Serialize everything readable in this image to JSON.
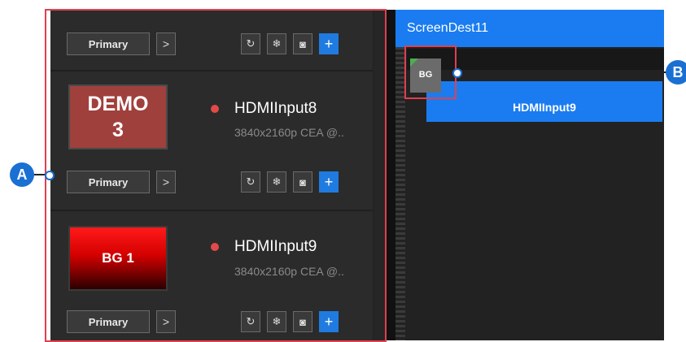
{
  "inputs_panel": {
    "items": [
      {
        "name": "",
        "resolution": "",
        "primary_label": "Primary",
        "chevron": ">",
        "toolbar": [
          "refresh-icon",
          "freeze-icon",
          "camera-icon",
          "add-icon"
        ]
      },
      {
        "thumb_text_1": "DEMO",
        "thumb_text_2": "3",
        "name": "HDMIInput8",
        "resolution": "3840x2160p CEA @..",
        "primary_label": "Primary",
        "chevron": ">",
        "status_color": "#e24a4a"
      },
      {
        "thumb_text": "BG 1",
        "name": "HDMIInput9",
        "resolution": "3840x2160p CEA @..",
        "primary_label": "Primary",
        "chevron": ">",
        "status_color": "#e24a4a"
      }
    ],
    "icons": {
      "refresh": "↻",
      "freeze": "❄",
      "camera": "◙",
      "add": "+"
    }
  },
  "destination": {
    "title": "ScreenDest11",
    "bg_chip": "BG",
    "layer_label": "HDMIInput9"
  },
  "callouts": {
    "a": "A",
    "b": "B"
  },
  "colors": {
    "accent": "#1a7cf0",
    "highlight": "#e04050",
    "panel": "#2b2b2b"
  }
}
